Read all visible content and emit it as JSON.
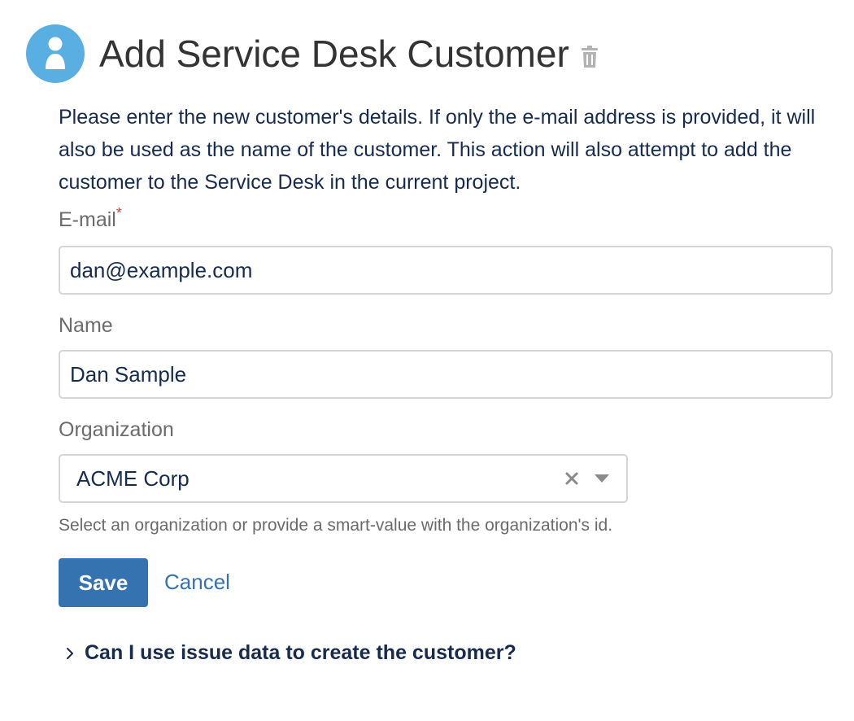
{
  "header": {
    "title": "Add Service Desk Customer",
    "icon": "user-avatar-icon",
    "accent_color": "#59afe1"
  },
  "description": "Please enter the new customer's details. If only the e-mail address is provided, it will also be used as the name of the customer. This action will also attempt to add the customer to the Service Desk in the current project.",
  "form": {
    "email": {
      "label": "E-mail",
      "required_marker": "*",
      "value": "dan@example.com"
    },
    "name": {
      "label": "Name",
      "value": "Dan Sample"
    },
    "organization": {
      "label": "Organization",
      "selected": "ACME Corp",
      "help": "Select an organization or provide a smart-value with the organization's id."
    }
  },
  "actions": {
    "save_label": "Save",
    "cancel_label": "Cancel",
    "primary_color": "#3572b0"
  },
  "expander": {
    "label": "Can I use issue data to create the customer?"
  }
}
